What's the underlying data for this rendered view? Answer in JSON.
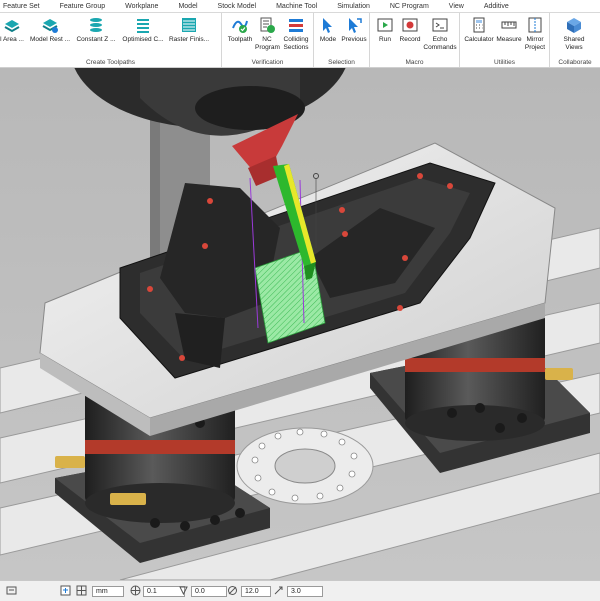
{
  "menubar": {
    "tabs": [
      "Feature Set",
      "Feature Group",
      "Workplane",
      "Model",
      "Stock Model",
      "Machine Tool",
      "Simulation",
      "NC Program",
      "View",
      "Additive"
    ]
  },
  "ribbon": {
    "groups": {
      "create_toolpaths": {
        "label": "Create Toolpaths",
        "buttons": [
          "l Area ...",
          "Model Rest ...",
          "Constant Z ...",
          "Optimised C...",
          "Raster Finis..."
        ]
      },
      "verification": {
        "label": "Verification",
        "buttons": [
          "Toolpath",
          "NC Program",
          "Colliding Sections"
        ]
      },
      "selection": {
        "label": "Selection",
        "buttons": [
          "Mode",
          "Previous"
        ]
      },
      "macro": {
        "label": "Macro",
        "buttons": [
          "Run",
          "Record",
          "Echo Commands"
        ]
      },
      "utilities": {
        "label": "Utilities",
        "buttons": [
          "Calculator",
          "Measure",
          "Mirror Project"
        ]
      },
      "collaborate": {
        "label": "Collaborate",
        "buttons": [
          "Shared Views"
        ]
      }
    }
  },
  "statusbar": {
    "units": "mm",
    "tolerance": "0.1",
    "thickness": "0.0",
    "diameter": "12.0",
    "stepover": "3.0"
  },
  "colors": {
    "accent": "#1e7bd6",
    "viewport_bg": "#bcbcbc",
    "tool_holder": "#c83a3a",
    "tool": "#2db82d",
    "toolpath": "#7fe08f",
    "fixture_band": "#b33a2a"
  }
}
